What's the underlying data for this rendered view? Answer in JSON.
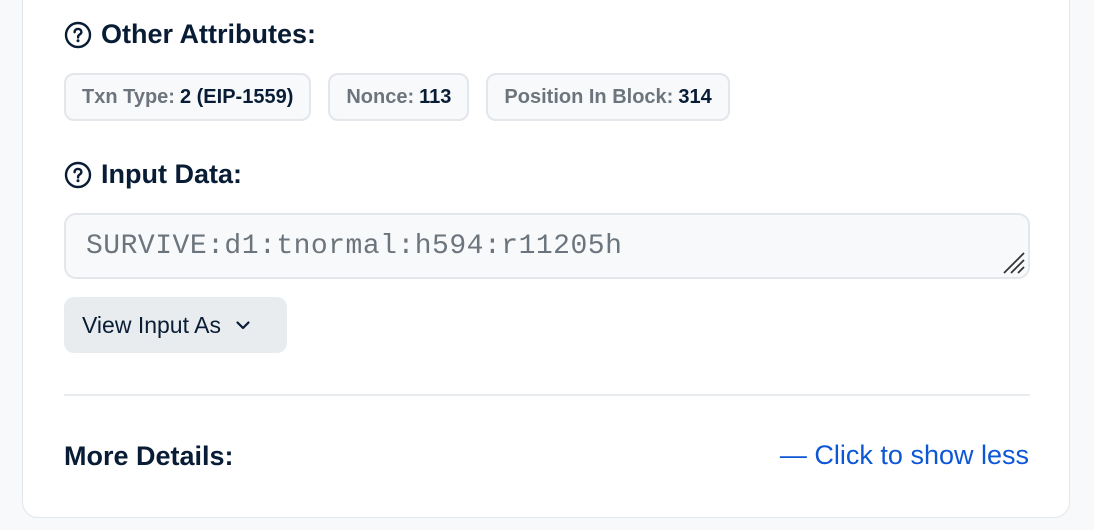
{
  "other_attributes": {
    "title": "Other Attributes:",
    "badges": [
      {
        "key": "Txn Type:",
        "value": "2 (EIP-1559)"
      },
      {
        "key": "Nonce:",
        "value": "113"
      },
      {
        "key": "Position In Block:",
        "value": "314"
      }
    ]
  },
  "input_data": {
    "title": "Input Data:",
    "value": "SURVIVE:d1:tnormal:h594:r11205h",
    "view_button_label": "View Input As"
  },
  "more_details": {
    "label": "More Details:",
    "toggle_label": "— Click to show less"
  },
  "colors": {
    "link": "#0d57d6",
    "text": "#081d35",
    "muted": "#6c757d"
  }
}
